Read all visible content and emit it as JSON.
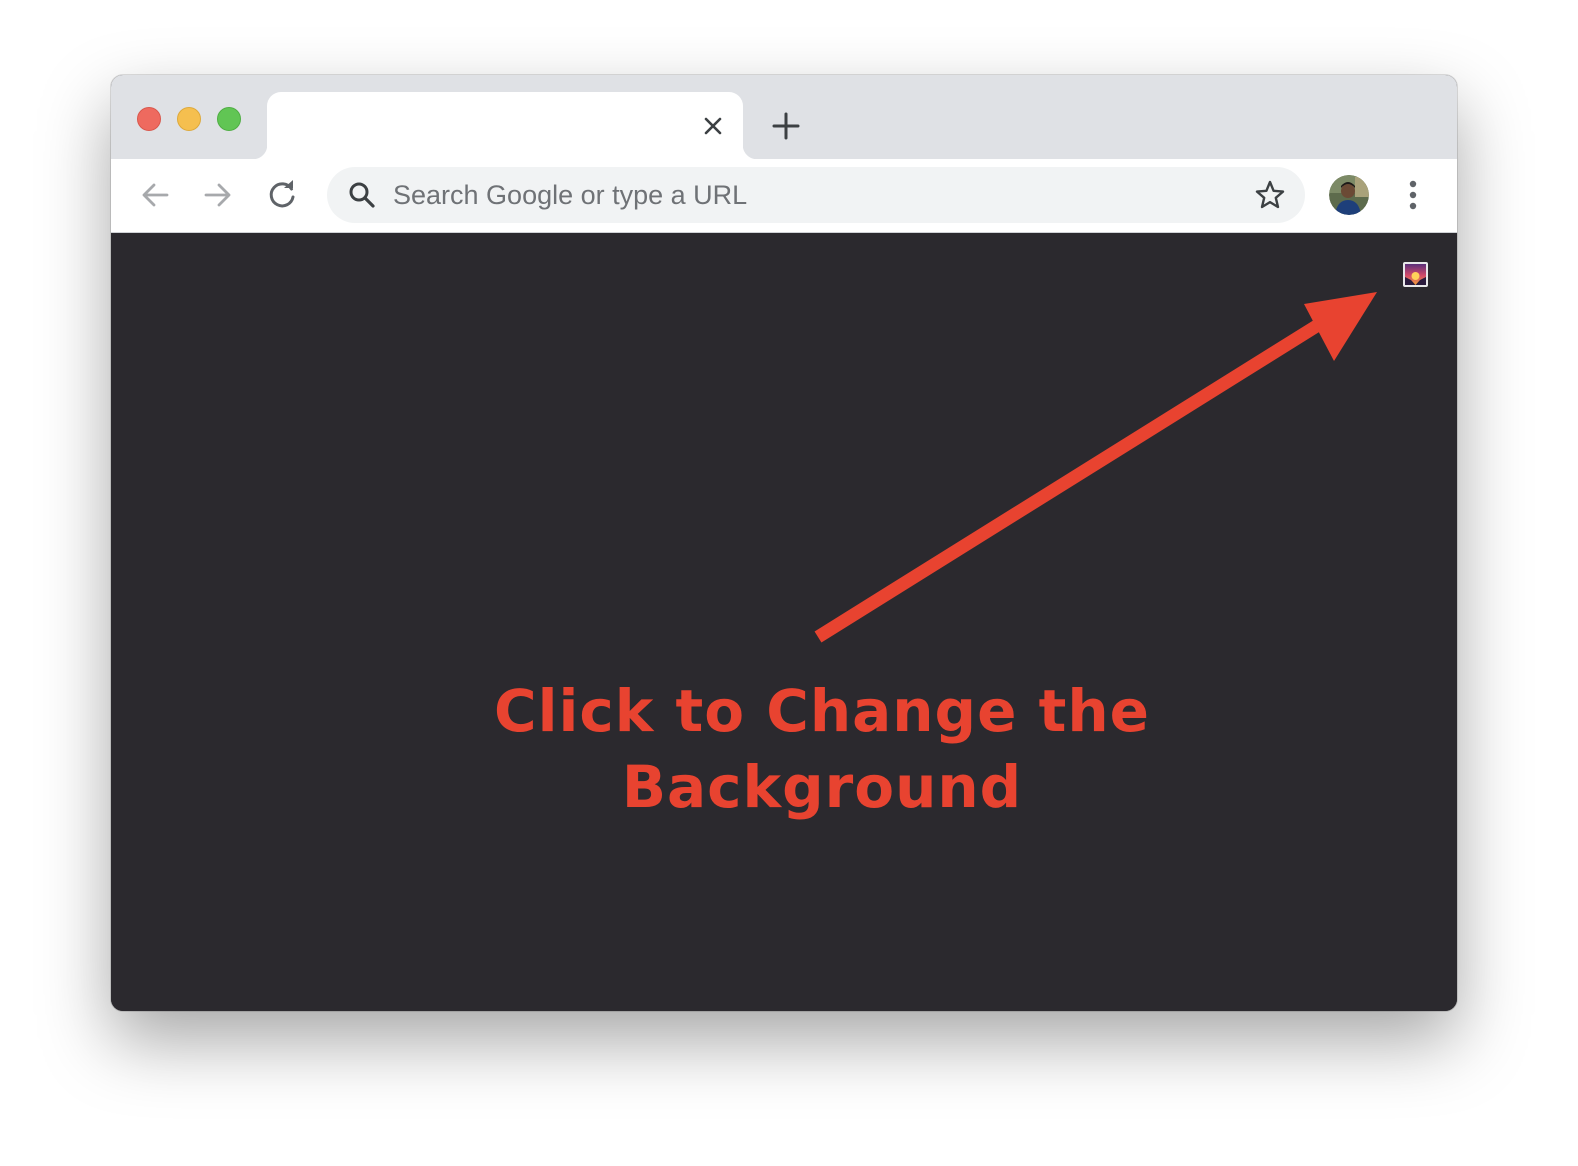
{
  "window": {
    "traffic_lights": [
      "close",
      "minimize",
      "zoom"
    ],
    "colors": {
      "close": "#ee6a5f",
      "minimize": "#f5bf4f",
      "zoom": "#61c554",
      "content_background": "#2b292e"
    }
  },
  "tabs": {
    "active_tab": {
      "title": "",
      "close_icon": "close-icon"
    },
    "new_tab_icon": "plus-icon"
  },
  "toolbar": {
    "back_icon": "arrow-left-icon",
    "forward_icon": "arrow-right-icon",
    "reload_icon": "reload-icon",
    "omnibox": {
      "search_icon": "search-icon",
      "placeholder": "Search Google or type a URL",
      "value": ""
    },
    "bookmark_icon": "star-icon",
    "profile_icon": "avatar",
    "menu_icon": "more-vert-icon"
  },
  "content": {
    "customize_icon": "image-icon",
    "annotation": {
      "line1": "Click to Change the",
      "line2": "Background",
      "color": "#e84330"
    }
  }
}
